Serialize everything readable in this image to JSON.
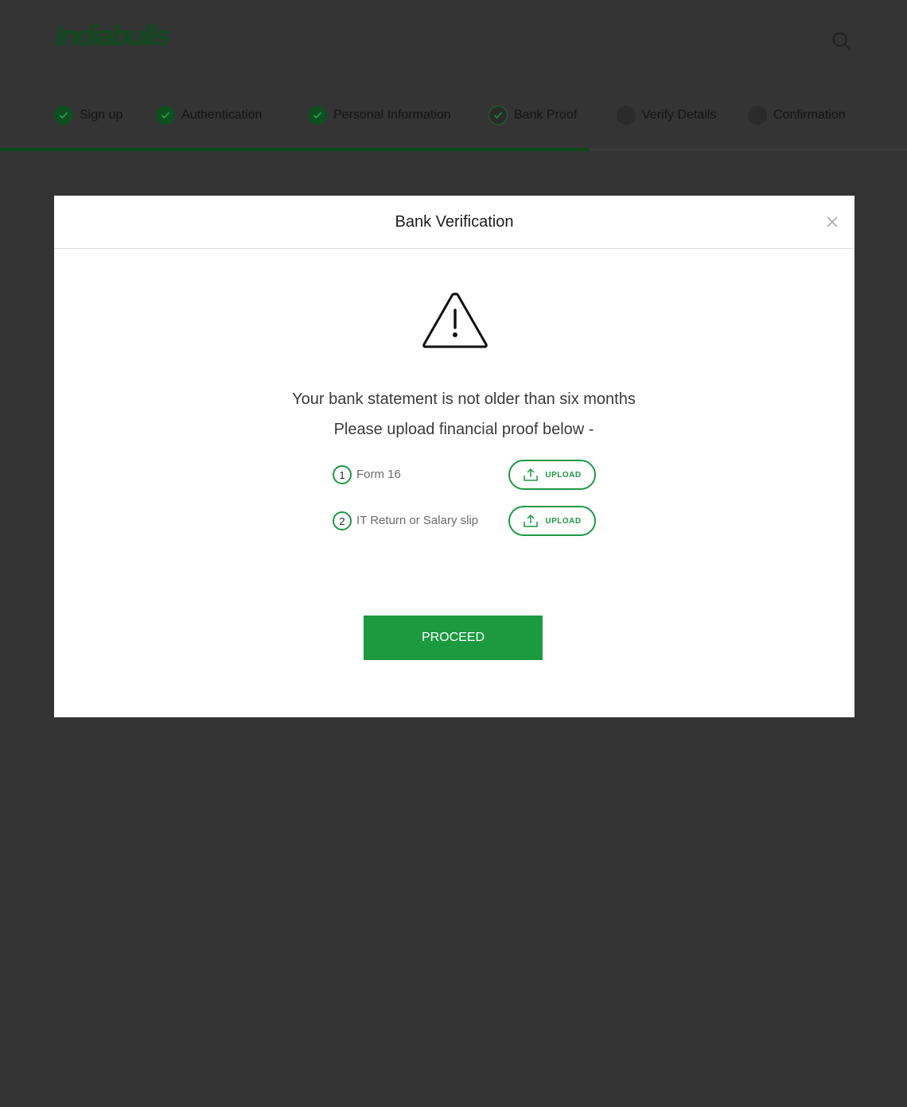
{
  "brand": {
    "logo_text": "Indiabulls",
    "accent": "#1b9a3f"
  },
  "header": {
    "search_icon": "search-icon",
    "steps": [
      {
        "label": "Sign up",
        "status": "done"
      },
      {
        "label": "Authentication",
        "status": "done"
      },
      {
        "label": "Personal Information",
        "status": "done"
      },
      {
        "label": "Bank Proof",
        "status": "current"
      },
      {
        "label": "Verify Details",
        "status": "todo"
      },
      {
        "label": "Confirmation",
        "status": "todo"
      }
    ],
    "progress_fraction": 0.65
  },
  "modal": {
    "title": "Bank Verification",
    "close_icon": "close-icon",
    "warning_icon": "warning-icon",
    "message": "Your bank statement is not older than six months",
    "instruction": "Please upload financial proof below -",
    "documents": [
      {
        "number": "1",
        "label": "Form 16",
        "button_label": "UPLOAD"
      },
      {
        "number": "2",
        "label": "IT Return or Salary slip",
        "button_label": "UPLOAD"
      }
    ],
    "proceed_label": "PROCEED"
  }
}
